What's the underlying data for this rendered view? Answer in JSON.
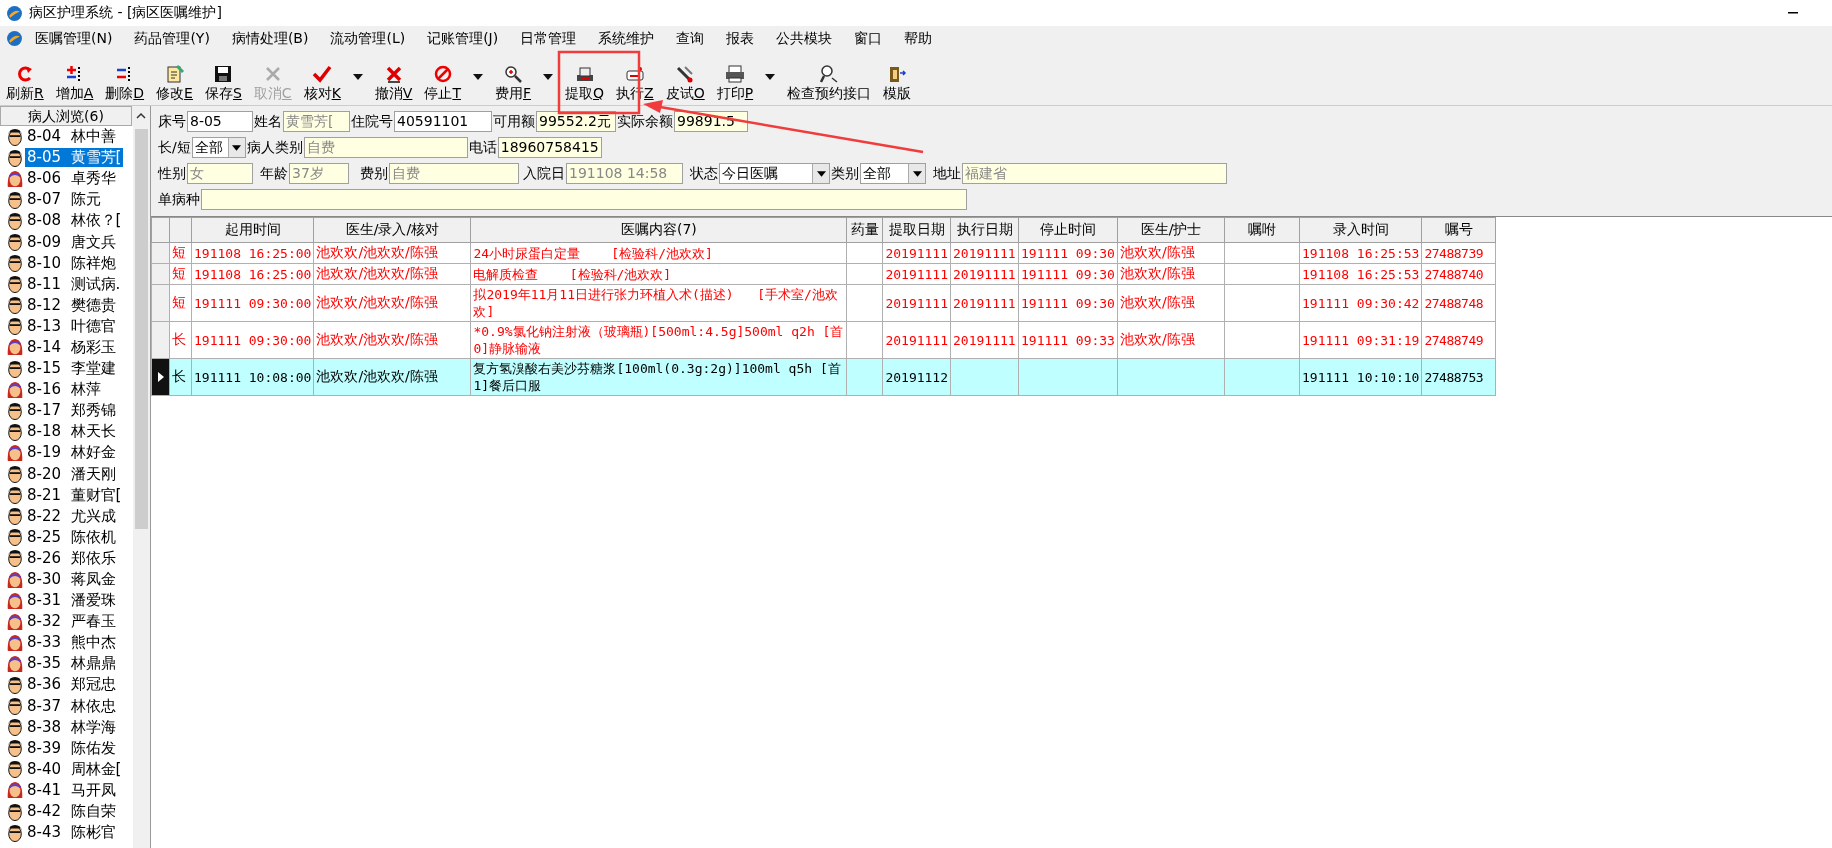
{
  "window": {
    "title": "病区护理系统 - [病区医嘱维护]"
  },
  "menu": [
    {
      "label": "医嘱管理(N)"
    },
    {
      "label": "药品管理(Y)"
    },
    {
      "label": "病情处理(B)"
    },
    {
      "label": "流动管理(L)"
    },
    {
      "label": "记账管理(J)"
    },
    {
      "label": "日常管理"
    },
    {
      "label": "系统维护"
    },
    {
      "label": "查询"
    },
    {
      "label": "报表"
    },
    {
      "label": "公共模块"
    },
    {
      "label": "窗口"
    },
    {
      "label": "帮助"
    }
  ],
  "toolbar": [
    {
      "label": "刷新",
      "key": "R",
      "disabled": false,
      "dropdown": false
    },
    {
      "label": "增加",
      "key": "A",
      "disabled": false,
      "dropdown": false
    },
    {
      "label": "删除",
      "key": "D",
      "disabled": false,
      "dropdown": false
    },
    {
      "label": "修改",
      "key": "E",
      "disabled": false,
      "dropdown": false
    },
    {
      "label": "保存",
      "key": "S",
      "disabled": false,
      "dropdown": false
    },
    {
      "label": "取消",
      "key": "C",
      "disabled": true,
      "dropdown": false
    },
    {
      "label": "核对",
      "key": "K",
      "disabled": false,
      "dropdown": true
    },
    {
      "label": "撤消",
      "key": "V",
      "disabled": false,
      "dropdown": false
    },
    {
      "label": "停止",
      "key": "T",
      "disabled": false,
      "dropdown": true
    },
    {
      "label": "费用",
      "key": "F",
      "disabled": false,
      "dropdown": true
    },
    {
      "label": "提取",
      "key": "Q",
      "disabled": false,
      "dropdown": false
    },
    {
      "label": "执行",
      "key": "Z",
      "disabled": false,
      "dropdown": false
    },
    {
      "label": "皮试",
      "key": "O",
      "disabled": false,
      "dropdown": false
    },
    {
      "label": "打印",
      "key": "P",
      "disabled": false,
      "dropdown": true
    },
    {
      "label": "检查预约接口",
      "disabled": false,
      "dropdown": false
    },
    {
      "label": "模版",
      "disabled": false,
      "dropdown": false
    }
  ],
  "patients": {
    "title": "病人浏览(6)",
    "items": [
      {
        "bed": "8-04",
        "name": "林中善",
        "kind": "male",
        "selected": false
      },
      {
        "bed": "8-05",
        "name": "黄雪芳[",
        "kind": "male",
        "selected": true
      },
      {
        "bed": "8-06",
        "name": "卓秀华",
        "kind": "female",
        "selected": false
      },
      {
        "bed": "8-07",
        "name": "陈元",
        "kind": "male",
        "selected": false
      },
      {
        "bed": "8-08",
        "name": "林依？[",
        "kind": "male",
        "selected": false
      },
      {
        "bed": "8-09",
        "name": "唐文兵",
        "kind": "male",
        "selected": false
      },
      {
        "bed": "8-10",
        "name": "陈祥炮",
        "kind": "male",
        "selected": false
      },
      {
        "bed": "8-11",
        "name": "测试病.",
        "kind": "male",
        "selected": false
      },
      {
        "bed": "8-12",
        "name": "樊德贵",
        "kind": "male",
        "selected": false
      },
      {
        "bed": "8-13",
        "name": "叶德官",
        "kind": "male",
        "selected": false
      },
      {
        "bed": "8-14",
        "name": "杨彩玉",
        "kind": "female",
        "selected": false
      },
      {
        "bed": "8-15",
        "name": "李堂建",
        "kind": "male",
        "selected": false
      },
      {
        "bed": "8-16",
        "name": "林萍",
        "kind": "female",
        "selected": false
      },
      {
        "bed": "8-17",
        "name": "郑秀锦",
        "kind": "male",
        "selected": false
      },
      {
        "bed": "8-18",
        "name": "林天长",
        "kind": "male",
        "selected": false
      },
      {
        "bed": "8-19",
        "name": "林好金",
        "kind": "female",
        "selected": false
      },
      {
        "bed": "8-20",
        "name": "潘天刚",
        "kind": "male",
        "selected": false
      },
      {
        "bed": "8-21",
        "name": "董财官[",
        "kind": "male",
        "selected": false
      },
      {
        "bed": "8-22",
        "name": "尤兴成",
        "kind": "male",
        "selected": false
      },
      {
        "bed": "8-25",
        "name": "陈依机",
        "kind": "male",
        "selected": false
      },
      {
        "bed": "8-26",
        "name": "郑依乐",
        "kind": "male",
        "selected": false
      },
      {
        "bed": "8-30",
        "name": "蒋凤金",
        "kind": "female",
        "selected": false
      },
      {
        "bed": "8-31",
        "name": "潘爱珠",
        "kind": "female",
        "selected": false
      },
      {
        "bed": "8-32",
        "name": "严春玉",
        "kind": "female",
        "selected": false
      },
      {
        "bed": "8-33",
        "name": "熊中杰",
        "kind": "female",
        "selected": false
      },
      {
        "bed": "8-35",
        "name": "林鼎鼎",
        "kind": "female",
        "selected": false
      },
      {
        "bed": "8-36",
        "name": "郑冠忠",
        "kind": "male",
        "selected": false
      },
      {
        "bed": "8-37",
        "name": "林依忠",
        "kind": "male",
        "selected": false
      },
      {
        "bed": "8-38",
        "name": "林学海",
        "kind": "male",
        "selected": false
      },
      {
        "bed": "8-39",
        "name": "陈佑发",
        "kind": "male",
        "selected": false
      },
      {
        "bed": "8-40",
        "name": "周林金[",
        "kind": "male",
        "selected": false
      },
      {
        "bed": "8-41",
        "name": "马开凤",
        "kind": "female",
        "selected": false
      },
      {
        "bed": "8-42",
        "name": "陈自荣",
        "kind": "male",
        "selected": false
      },
      {
        "bed": "8-43",
        "name": "陈彬官",
        "kind": "male",
        "selected": false
      }
    ]
  },
  "form": [
    [
      {
        "kind": "label",
        "text": "床号"
      },
      {
        "kind": "input",
        "value": "8-05"
      },
      {
        "kind": "label",
        "text": "姓名"
      },
      {
        "kind": "readonly",
        "value": "黄雪芳["
      },
      {
        "kind": "label",
        "text": "住院号"
      },
      {
        "kind": "input",
        "value": "40591101"
      },
      {
        "kind": "label",
        "text": "可用额"
      },
      {
        "kind": "display",
        "value": "99552.2元"
      },
      {
        "kind": "label",
        "text": "实际余额"
      },
      {
        "kind": "display",
        "value": "99891.5"
      }
    ],
    [
      {
        "kind": "label",
        "text": "长/短"
      },
      {
        "kind": "select",
        "value": "全部"
      },
      {
        "kind": "label",
        "text": "病人类别"
      },
      {
        "kind": "readonly",
        "value": "自费"
      },
      {
        "kind": "label",
        "text": "电话"
      },
      {
        "kind": "display",
        "value": "18960758415"
      }
    ],
    [
      {
        "kind": "label",
        "text": "性别"
      },
      {
        "kind": "readonly",
        "value": "女"
      },
      {
        "kind": "label",
        "text": "年龄"
      },
      {
        "kind": "readonly",
        "value": "37岁"
      },
      {
        "kind": "label",
        "text": "费别"
      },
      {
        "kind": "readonly",
        "value": "自费"
      },
      {
        "kind": "label",
        "text": "入院日"
      },
      {
        "kind": "readonly",
        "value": "191108 14:58"
      },
      {
        "kind": "label",
        "text": "状态"
      },
      {
        "kind": "select",
        "value": "今日医嘱"
      },
      {
        "kind": "label",
        "text": "类别"
      },
      {
        "kind": "select",
        "value": "全部"
      },
      {
        "kind": "label",
        "text": "地址"
      },
      {
        "kind": "readonly",
        "value": "福建省"
      }
    ],
    [
      {
        "kind": "label",
        "text": "单病种"
      },
      {
        "kind": "readonly"
      }
    ]
  ],
  "table": {
    "columns": [
      "",
      "起用时间",
      "医生/录入/核对",
      "医嘱内容(7)",
      "药量",
      "提取日期",
      "执行日期",
      "停止时间",
      "医生/护士",
      "嘱咐",
      "录入时间",
      "嘱号"
    ],
    "rows": [
      {
        "selected": false,
        "color": "#ff0000",
        "cells": [
          "短",
          "191108 16:25:00",
          "池欢欢/池欢欢/陈强",
          "24小时尿蛋白定量    [检验科/池欢欢]",
          "",
          "20191111",
          "20191111",
          "191111 09:30",
          "池欢欢/陈强",
          "",
          "191108 16:25:53",
          "27488739"
        ]
      },
      {
        "selected": false,
        "color": "#ff0000",
        "cells": [
          "短",
          "191108 16:25:00",
          "池欢欢/池欢欢/陈强",
          "电解质检查    [检验科/池欢欢]",
          "",
          "20191111",
          "20191111",
          "191111 09:30",
          "池欢欢/陈强",
          "",
          "191108 16:25:53",
          "27488740"
        ]
      },
      {
        "selected": false,
        "color": "#ff0000",
        "cells": [
          "短",
          "191111 09:30:00",
          "池欢欢/池欢欢/陈强",
          "拟2019年11月11日进行张力环植入术(描述)   [手术室/池欢欢]",
          "",
          "20191111",
          "20191111",
          "191111 09:30",
          "池欢欢/陈强",
          "",
          "191111 09:30:42",
          "27488748"
        ]
      },
      {
        "selected": false,
        "color": "#ff0000",
        "cells": [
          "长",
          "191111 09:30:00",
          "池欢欢/池欢欢/陈强",
          "*0.9%氯化钠注射液（玻璃瓶)[500ml:4.5g]500ml q2h [首0]静脉输液",
          "",
          "20191111",
          "20191111",
          "191111 09:33",
          "池欢欢/陈强",
          "",
          "191111 09:31:19",
          "27488749"
        ]
      },
      {
        "selected": true,
        "color": "#000000",
        "cells": [
          "长",
          "191111 10:08:00",
          "池欢欢/池欢欢/陈强",
          "复方氢溴酸右美沙芬糖浆[100ml(0.3g:2g)]100ml q5h [首1]餐后口服",
          "",
          "20191112",
          "",
          "",
          "",
          "",
          "191111 10:10:10",
          "27488753"
        ]
      }
    ]
  }
}
